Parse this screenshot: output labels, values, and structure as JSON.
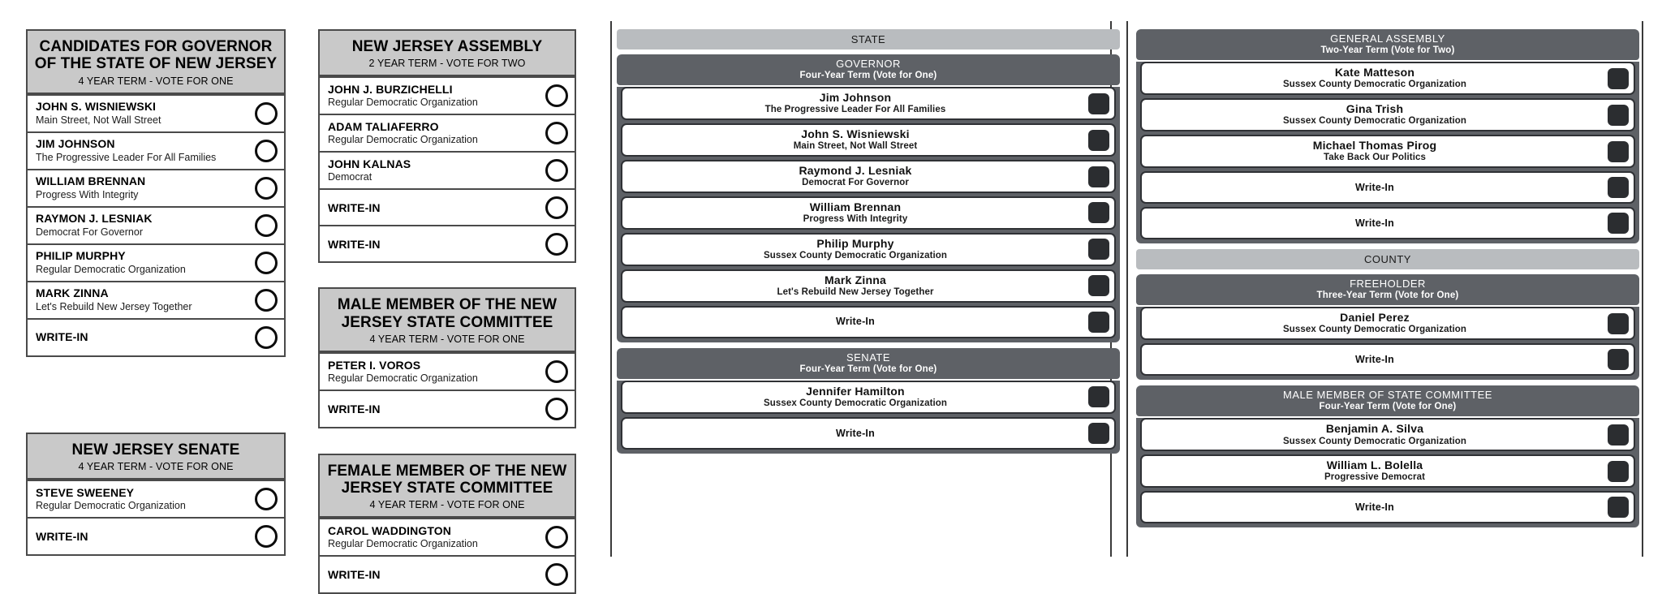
{
  "meta": {
    "title": "Sample Ballot Comparison",
    "colors": {
      "paper_header_bg": "#c9c9c9",
      "paper_border": "#4a4a4a",
      "section_banner_bg": "#b9bcbf",
      "office_header_bg": "#5e6166",
      "machine_border": "#2f3135",
      "target_fill": "#2b2d30",
      "page_bg": "#ffffff"
    }
  },
  "paper_ballot": {
    "columns": [
      {
        "id": "paper-col-1",
        "boxes": [
          {
            "id": "governor",
            "header": {
              "title": "CANDIDATES FOR GOVERNOR OF THE STATE OF NEW JERSEY",
              "subtitle": "4 YEAR TERM - VOTE FOR ONE"
            },
            "rows": [
              {
                "name": "JOHN S. WISNIEWSKI",
                "party": "Main Street, Not Wall Street",
                "target": "oval"
              },
              {
                "name": "JIM JOHNSON",
                "party": "The Progressive Leader For All Families",
                "target": "oval"
              },
              {
                "name": "WILLIAM BRENNAN",
                "party": "Progress With Integrity",
                "target": "oval"
              },
              {
                "name": "RAYMON J. LESNIAK",
                "party": "Democrat For Governor",
                "target": "oval"
              },
              {
                "name": "PHILIP MURPHY",
                "party": "Regular Democratic Organization",
                "target": "oval"
              },
              {
                "name": "MARK ZINNA",
                "party": "Let's Rebuild New Jersey Together",
                "target": "oval"
              },
              {
                "name": "WRITE-IN",
                "party": "",
                "target": "oval"
              }
            ]
          },
          {
            "id": "nj-senate",
            "header": {
              "title": "NEW JERSEY SENATE",
              "subtitle": "4 YEAR TERM - VOTE FOR ONE"
            },
            "rows": [
              {
                "name": "STEVE SWEENEY",
                "party": "Regular Democratic Organization",
                "target": "oval"
              },
              {
                "name": "WRITE-IN",
                "party": "",
                "target": "oval"
              }
            ]
          }
        ]
      },
      {
        "id": "paper-col-2",
        "boxes": [
          {
            "id": "nj-assembly",
            "header": {
              "title": "NEW JERSEY ASSEMBLY",
              "subtitle": "2 YEAR TERM - VOTE FOR TWO"
            },
            "rows": [
              {
                "name": "JOHN J. BURZICHELLI",
                "party": "Regular Democratic Organization",
                "target": "oval"
              },
              {
                "name": "ADAM TALIAFERRO",
                "party": "Regular Democratic Organization",
                "target": "oval"
              },
              {
                "name": "JOHN KALNAS",
                "party": "Democrat",
                "target": "oval"
              },
              {
                "name": "WRITE-IN",
                "party": "",
                "target": "oval"
              },
              {
                "name": "WRITE-IN",
                "party": "",
                "target": "oval"
              }
            ]
          },
          {
            "id": "male-state-committee",
            "header": {
              "title": "MALE MEMBER OF THE NEW JERSEY STATE COMMITTEE",
              "subtitle": "4 YEAR TERM - VOTE FOR ONE"
            },
            "rows": [
              {
                "name": "PETER I. VOROS",
                "party": "Regular Democratic Organization",
                "target": "oval"
              },
              {
                "name": "WRITE-IN",
                "party": "",
                "target": "oval"
              }
            ]
          },
          {
            "id": "female-state-committee",
            "header": {
              "title": "FEMALE MEMBER OF THE NEW JERSEY STATE COMMITTEE",
              "subtitle": "4 YEAR TERM - VOTE FOR ONE"
            },
            "rows": [
              {
                "name": "CAROL WADDINGTON",
                "party": "Regular Democratic Organization",
                "target": "oval"
              },
              {
                "name": "WRITE-IN",
                "party": "",
                "target": "oval"
              }
            ]
          }
        ]
      }
    ]
  },
  "machine_ballot": {
    "columns": [
      {
        "id": "machine-col-1",
        "blocks": [
          {
            "id": "state-section",
            "banner": "STATE",
            "office": {
              "title": "GOVERNOR",
              "subtitle": "Four-Year Term (Vote for One)"
            },
            "candidates": [
              {
                "name": "Jim Johnson",
                "party": "The Progressive Leader For All Families",
                "writein": false
              },
              {
                "name": "John S. Wisniewski",
                "party": "Main Street, Not Wall Street",
                "writein": false
              },
              {
                "name": "Raymond J. Lesniak",
                "party": "Democrat For Governor",
                "writein": false
              },
              {
                "name": "William Brennan",
                "party": "Progress With Integrity",
                "writein": false
              },
              {
                "name": "Philip Murphy",
                "party": "Sussex County Democratic Organization",
                "writein": false
              },
              {
                "name": "Mark Zinna",
                "party": "Let's Rebuild New Jersey Together",
                "writein": false
              },
              {
                "name": "Write-In",
                "party": "",
                "writein": true
              }
            ]
          },
          {
            "id": "senate",
            "banner": "",
            "office": {
              "title": "SENATE",
              "subtitle": "Four-Year Term (Vote for One)"
            },
            "candidates": [
              {
                "name": "Jennifer Hamilton",
                "party": "Sussex County Democratic Organization",
                "writein": false
              },
              {
                "name": "Write-In",
                "party": "",
                "writein": true
              }
            ]
          }
        ]
      },
      {
        "id": "machine-col-2",
        "blocks": [
          {
            "id": "general-assembly",
            "banner": "",
            "office": {
              "title": "GENERAL ASSEMBLY",
              "subtitle": "Two-Year Term (Vote for Two)"
            },
            "candidates": [
              {
                "name": "Kate Matteson",
                "party": "Sussex County Democratic Organization",
                "writein": false
              },
              {
                "name": "Gina Trish",
                "party": "Sussex County Democratic Organization",
                "writein": false
              },
              {
                "name": "Michael Thomas Pirog",
                "party": "Take Back Our Politics",
                "writein": false
              },
              {
                "name": "Write-In",
                "party": "",
                "writein": true
              },
              {
                "name": "Write-In",
                "party": "",
                "writein": true
              }
            ]
          },
          {
            "id": "freeholder",
            "banner": "COUNTY",
            "office": {
              "title": "FREEHOLDER",
              "subtitle": "Three-Year Term (Vote for One)"
            },
            "candidates": [
              {
                "name": "Daniel Perez",
                "party": "Sussex County Democratic Organization",
                "writein": false
              },
              {
                "name": "Write-In",
                "party": "",
                "writein": true
              }
            ]
          },
          {
            "id": "male-member-state-committee",
            "banner": "",
            "office": {
              "title": "MALE MEMBER OF STATE COMMITTEE",
              "subtitle": "Four-Year Term (Vote for One)"
            },
            "candidates": [
              {
                "name": "Benjamin A. Silva",
                "party": "Sussex County Democratic Organization",
                "writein": false
              },
              {
                "name": "William L. Bolella",
                "party": "Progressive Democrat",
                "writein": false
              },
              {
                "name": "Write-In",
                "party": "",
                "writein": true
              }
            ]
          }
        ]
      }
    ]
  }
}
